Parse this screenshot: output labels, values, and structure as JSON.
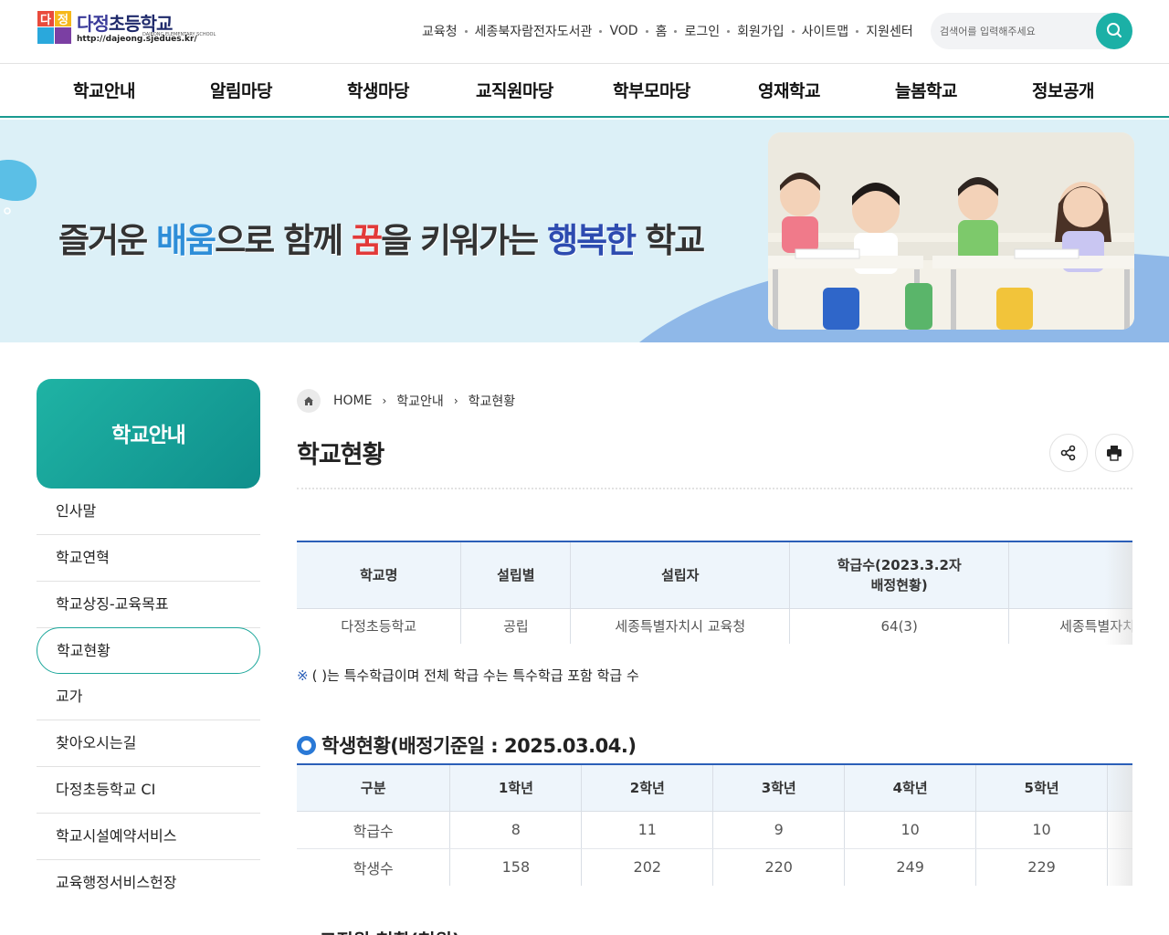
{
  "logo": {
    "name_a": "다정",
    "name_b": "초등학교",
    "english": "DAJEONG ELEMENTARY SCHOOL",
    "url": "http://dajeong.sjedues.kr/"
  },
  "util_links": [
    "교육청",
    "세종북자람전자도서관",
    "VOD",
    "홈",
    "로그인",
    "회원가입",
    "사이트맵",
    "지원센터"
  ],
  "search": {
    "placeholder": "검색어를 입력해주세요"
  },
  "gnb": [
    "학교안내",
    "알림마당",
    "학생마당",
    "교직원마당",
    "학부모마당",
    "영재학교",
    "늘봄학교",
    "정보공개"
  ],
  "hero": {
    "parts": [
      "즐거운 ",
      "배움",
      "으로 함께 ",
      "꿈",
      "을 키워가는 ",
      "행복한",
      " 학교"
    ]
  },
  "sidebar": {
    "title": "학교안내",
    "items": [
      "인사말",
      "학교연혁",
      "학교상징-교육목표",
      "학교현황",
      "교가",
      "찾아오시는길",
      "다정초등학교 CI",
      "학교시설예약서비스",
      "교육행정서비스헌장"
    ],
    "active_index": 3
  },
  "breadcrumb": {
    "home": "HOME",
    "level1": "학교안내",
    "level2": "학교현황"
  },
  "page_title": "학교현황",
  "school_table": {
    "headers": [
      "학교명",
      "설립별",
      "설립자",
      "학급수(2023.3.2자\n배정현황)",
      ""
    ],
    "row": [
      "다정초등학교",
      "공립",
      "세종특별자치시 교육청",
      "64(3)",
      "세종특별자치"
    ]
  },
  "note": {
    "mark": "※",
    "text": "( )는 특수학급이며 전체 학급 수는 특수학급 포함 학급 수"
  },
  "students_section": {
    "title": "학생현황(배정기준일 : 2025.03.04.)",
    "headers": [
      "구분",
      "1학년",
      "2학년",
      "3학년",
      "4학년",
      "5학년",
      ""
    ],
    "rows": [
      [
        "학급수",
        "8",
        "11",
        "9",
        "10",
        "10",
        ""
      ],
      [
        "학생수",
        "158",
        "202",
        "220",
        "249",
        "229",
        ""
      ]
    ]
  },
  "next_section_title": "교직원 현황(현원)",
  "colors": {
    "accent": "#1aa69a",
    "table_top": "#2b5fb8",
    "hero_bg": "#dcf0f7"
  }
}
